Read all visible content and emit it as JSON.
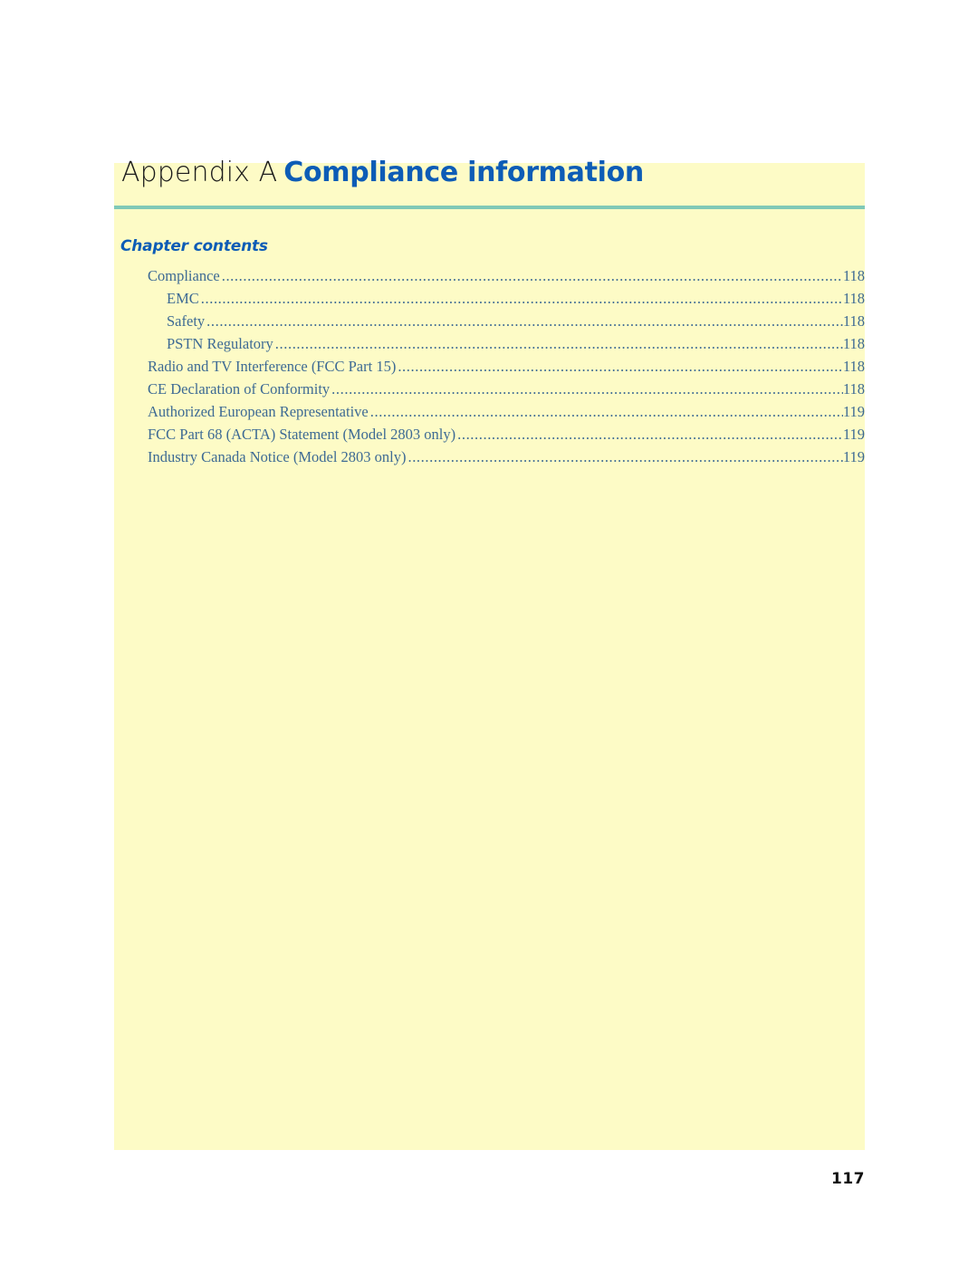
{
  "page": {
    "background_color": "#ffffff",
    "panel_color": "#fdfbc6",
    "rule_color": "#80c9b7",
    "accent_blue": "#0d5cb6",
    "toc_text_color": "#3d6a94",
    "folio": "117"
  },
  "header": {
    "appendix_label": "Appendix A",
    "appendix_name": "Compliance information"
  },
  "contents": {
    "heading": "Chapter contents",
    "entries": [
      {
        "label": "Compliance",
        "page": "118",
        "level": 1
      },
      {
        "label": "EMC",
        "page": "118",
        "level": 2
      },
      {
        "label": "Safety",
        "page": "118",
        "level": 2
      },
      {
        "label": "PSTN Regulatory",
        "page": "118",
        "level": 2
      },
      {
        "label": "Radio and TV Interference (FCC Part 15)",
        "page": "118",
        "level": 1
      },
      {
        "label": "CE Declaration of Conformity",
        "page": "118",
        "level": 1
      },
      {
        "label": "Authorized European Representative",
        "page": "119",
        "level": 1
      },
      {
        "label": "FCC Part 68 (ACTA) Statement (Model 2803 only)",
        "page": "119",
        "level": 1
      },
      {
        "label": "Industry Canada Notice (Model 2803 only)",
        "page": "119",
        "level": 1
      }
    ]
  }
}
